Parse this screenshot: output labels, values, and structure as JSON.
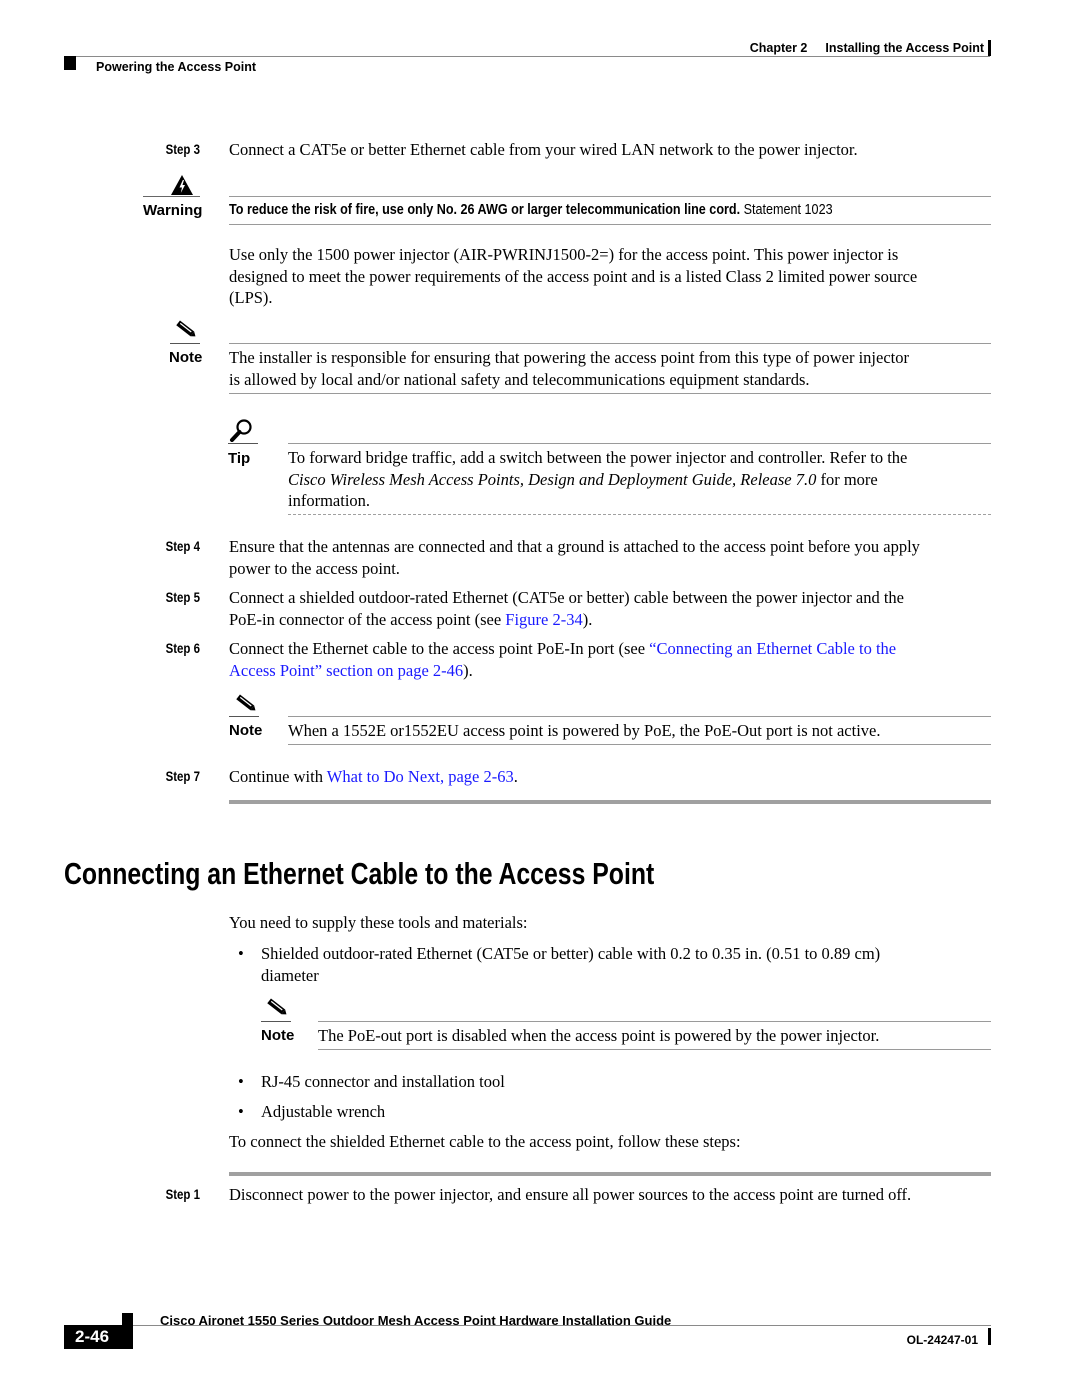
{
  "header": {
    "chapter": "Chapter 2",
    "chapter_title": "Installing the Access Point",
    "section": "Powering the Access Point"
  },
  "step3": {
    "label": "Step 3",
    "text": "Connect a CAT5e or better Ethernet cable from your wired LAN network to the power injector."
  },
  "warning": {
    "icon": "warning-icon",
    "label": "Warning",
    "bold_text": "To reduce the risk of fire, use only No. 26 AWG or larger telecommunication line cord.",
    "statement": "Statement 1023"
  },
  "injector_paragraph": {
    "line1": "Use only the 1500 power injector (AIR-PWRINJ1500-2=) for the access point. This power injector is",
    "line2": "designed to meet the power requirements of the access point and is a listed Class 2 limited power source",
    "line3": "(LPS)."
  },
  "note1": {
    "icon": "pencil-icon",
    "label": "Note",
    "line1": "The installer is responsible for ensuring that powering the access point from this type of power injector",
    "line2": "is allowed by local and/or national safety and telecommunications equipment standards."
  },
  "tip": {
    "icon": "magnifier-icon",
    "label": "Tip",
    "line1": "To forward bridge traffic, add a switch between the power injector and controller. Refer to the",
    "line2_italic": "Cisco Wireless Mesh Access Points, Design and Deployment Guide, Release 7.0",
    "line2_rest": " for more",
    "line3": "information."
  },
  "step4": {
    "label": "Step 4",
    "line1": "Ensure that the antennas are connected and that a ground is attached to the access point before you apply",
    "line2": "power to the access point."
  },
  "step5": {
    "label": "Step 5",
    "line1": "Connect a shielded outdoor-rated Ethernet (CAT5e or better) cable between the power injector and the",
    "line2_pre": "PoE-in connector of the access point (see ",
    "line2_link": "Figure 2-34",
    "line2_post": ")."
  },
  "step6": {
    "label": "Step 6",
    "line1_pre": "Connect the Ethernet cable to the access point PoE-In port (see ",
    "line1_link": "“Connecting an Ethernet Cable to the",
    "line2_link": "Access Point” section on page 2-46",
    "line2_post": ")."
  },
  "note2": {
    "icon": "pencil-icon",
    "label": "Note",
    "text": "When a 1552E or1552EU access point is powered by PoE, the PoE-Out port is not active."
  },
  "step7": {
    "label": "Step 7",
    "pre": "Continue with ",
    "link": "What to Do Next, page 2-63",
    "post": "."
  },
  "section": {
    "title": "Connecting an Ethernet Cable to the Access Point",
    "intro": "You need to supply these tools and materials:",
    "bullet1_line1": "Shielded outdoor-rated Ethernet (CAT5e or better) cable with 0.2 to 0.35 in. (0.51 to 0.89 cm)",
    "bullet1_line2": "diameter",
    "note": {
      "icon": "pencil-icon",
      "label": "Note",
      "text": "The PoE-out port is disabled when the access point is powered by the power injector."
    },
    "bullet2": "RJ-45 connector and installation tool",
    "bullet3": "Adjustable wrench",
    "steps_intro": "To connect the shielded Ethernet cable to the access point, follow these steps:",
    "step1": {
      "label": "Step 1",
      "text": "Disconnect power to the power injector, and ensure all power sources to the access point are turned off."
    }
  },
  "footer": {
    "guide_title": "Cisco Aironet 1550 Series Outdoor Mesh Access Point Hardware Installation Guide",
    "page_number": "2-46",
    "doc_id": "OL-24247-01"
  }
}
